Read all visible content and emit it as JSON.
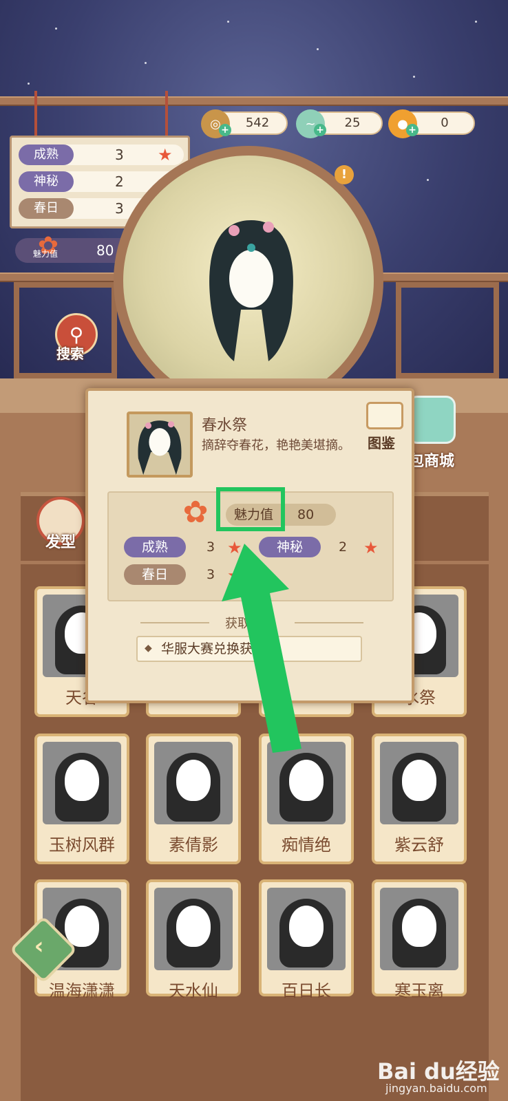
{
  "currency": [
    {
      "icon": "coin-icon",
      "value": "542",
      "color": "#d0a050"
    },
    {
      "icon": "jade-dragon-icon",
      "value": "25",
      "color": "#8fd0b8"
    },
    {
      "icon": "gold-ingot-icon",
      "value": "0",
      "color": "#f0a030"
    }
  ],
  "attributes": [
    {
      "label": "成熟",
      "value": "3"
    },
    {
      "label": "神秘",
      "value": "2"
    },
    {
      "label": "春日",
      "value": "3"
    }
  ],
  "charm": {
    "label": "魅力值",
    "value": "80"
  },
  "search_label": "搜索",
  "hair_tab_label": "发型",
  "shop_label": "包商城",
  "popup": {
    "title": "春水祭",
    "description": "摘辞夺春花，艳艳美堪摘。",
    "codex_label": "图鉴",
    "charm_label": "魅力值",
    "charm_value": "80",
    "stats": [
      {
        "label": "成熟",
        "value": "3"
      },
      {
        "label": "神秘",
        "value": "2"
      },
      {
        "label": "春日",
        "value": "3"
      }
    ],
    "obtain_title": "获取途径",
    "obtain_method": "华服大赛兑换获得"
  },
  "grid_items": [
    {
      "name": "天谷"
    },
    {
      "name": ""
    },
    {
      "name": ""
    },
    {
      "name": "水祭"
    },
    {
      "name": "玉树风群"
    },
    {
      "name": "素倩影"
    },
    {
      "name": "痴情绝"
    },
    {
      "name": "紫云舒"
    },
    {
      "name": "温海潇潇"
    },
    {
      "name": "天水仙"
    },
    {
      "name": "百日长"
    },
    {
      "name": "寒玉离"
    }
  ],
  "watermark": {
    "brand": "Bai du经验",
    "url": "jingyan.baidu.com"
  },
  "colors": {
    "highlight": "#22c55e",
    "arrow": "#22c55e"
  }
}
